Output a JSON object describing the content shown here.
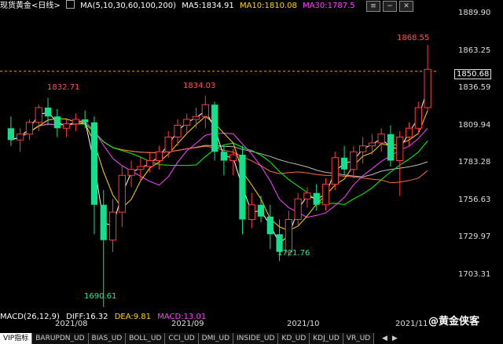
{
  "topbar": {
    "instrument": "现货黄金<日线>",
    "ma_label": "MA(5,10,30,60,100,200)",
    "ma5": "MA5:1834.91",
    "ma10": "MA10:1810.08",
    "ma30": "MA30:1787.5"
  },
  "yaxis": [
    "1889.90",
    "1863.25",
    "1836.59",
    "1809.94",
    "1783.28",
    "1756.63",
    "1729.97",
    "1703.31"
  ],
  "current_price": "1850.68",
  "annotations": {
    "h1": "1832.71",
    "h2": "1834.03",
    "h3": "1868.55",
    "l1": "1690.61",
    "l2": "1721.76"
  },
  "macd": {
    "label": "MACD(26,12,9)",
    "diff": "DIFF:16.32",
    "dea": "DEA:9.81",
    "macd": "MACD:13.01"
  },
  "dates": [
    "2021/08",
    "2021/09",
    "2021/10",
    "2021/11"
  ],
  "tabs": [
    "VIP指标",
    "BARUPDN_UD",
    "BIAS_UD",
    "BOLL_UD",
    "CCI_UD",
    "DMI_UD",
    "INSIDE_UD",
    "KD_UD",
    "KDJ_UD",
    "VR_UD"
  ],
  "watermark": "@黄金侠客",
  "colors": {
    "up": "#ff3b3b",
    "down": "#12e08c",
    "ma5": "#ffffff",
    "ma10": "#ffd700",
    "ma30": "#ff44ff",
    "ma60": "#00ff00",
    "ma100": "#ff6a3a",
    "ma200": "#bbbbbb"
  },
  "chart_data": {
    "type": "candlestick",
    "ylim": [
      1690,
      1890
    ],
    "candles": [
      [
        1812,
        1820,
        1800,
        1804
      ],
      [
        1804,
        1812,
        1796,
        1808
      ],
      [
        1808,
        1818,
        1804,
        1816
      ],
      [
        1816,
        1828,
        1810,
        1826
      ],
      [
        1826,
        1832.71,
        1814,
        1820
      ],
      [
        1820,
        1825,
        1806,
        1812
      ],
      [
        1812,
        1818,
        1806,
        1815
      ],
      [
        1815,
        1822,
        1810,
        1818
      ],
      [
        1818,
        1824,
        1812,
        1816
      ],
      [
        1816,
        1820,
        1740,
        1760
      ],
      [
        1760,
        1770,
        1690.61,
        1736
      ],
      [
        1736,
        1764,
        1728,
        1755
      ],
      [
        1755,
        1786,
        1745,
        1780
      ],
      [
        1780,
        1790,
        1772,
        1784
      ],
      [
        1784,
        1792,
        1776,
        1786
      ],
      [
        1786,
        1796,
        1782,
        1790
      ],
      [
        1790,
        1800,
        1784,
        1796
      ],
      [
        1796,
        1810,
        1792,
        1806
      ],
      [
        1806,
        1818,
        1800,
        1814
      ],
      [
        1814,
        1822,
        1808,
        1818
      ],
      [
        1818,
        1826,
        1812,
        1820
      ],
      [
        1820,
        1834.03,
        1812,
        1828
      ],
      [
        1828,
        1830,
        1790,
        1796
      ],
      [
        1796,
        1800,
        1780,
        1790
      ],
      [
        1790,
        1798,
        1780,
        1794
      ],
      [
        1794,
        1800,
        1740,
        1750
      ],
      [
        1750,
        1768,
        1744,
        1760
      ],
      [
        1760,
        1766,
        1748,
        1752
      ],
      [
        1752,
        1760,
        1730,
        1740
      ],
      [
        1740,
        1750,
        1721.76,
        1728
      ],
      [
        1728,
        1756,
        1725,
        1750
      ],
      [
        1750,
        1768,
        1746,
        1764
      ],
      [
        1764,
        1772,
        1758,
        1768
      ],
      [
        1768,
        1774,
        1756,
        1760
      ],
      [
        1760,
        1778,
        1756,
        1774
      ],
      [
        1774,
        1796,
        1770,
        1792
      ],
      [
        1792,
        1800,
        1780,
        1784
      ],
      [
        1784,
        1800,
        1778,
        1796
      ],
      [
        1796,
        1806,
        1788,
        1800
      ],
      [
        1800,
        1808,
        1794,
        1802
      ],
      [
        1802,
        1812,
        1796,
        1808
      ],
      [
        1808,
        1814,
        1786,
        1790
      ],
      [
        1790,
        1810,
        1766,
        1806
      ],
      [
        1806,
        1816,
        1800,
        1812
      ],
      [
        1812,
        1830,
        1808,
        1826
      ],
      [
        1826,
        1868.55,
        1824,
        1852
      ]
    ]
  }
}
